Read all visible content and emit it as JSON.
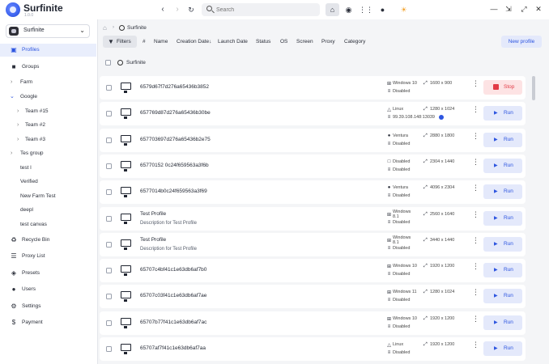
{
  "app": {
    "name": "Surfinite",
    "version": "1.0.0"
  },
  "topbar": {
    "search_placeholder": "Search",
    "back_icon": "chevron-left-icon",
    "forward_icon": "chevron-right-icon",
    "reload_icon": "reload-icon",
    "home_icon": "home-icon",
    "browser_icon": "chrome-icon",
    "sliders_icon": "sliders-icon",
    "account_icon": "account-icon",
    "theme_icon": "sun-icon"
  },
  "sidebar": {
    "workspace": "Surfinite",
    "items": [
      {
        "label": "Profiles",
        "icon": "monitor-icon",
        "active": true
      },
      {
        "label": "Groups",
        "icon": "folder-icon"
      }
    ],
    "groups": [
      {
        "label": "Farm",
        "expanded": false,
        "level": 0
      },
      {
        "label": "Google",
        "expanded": true,
        "level": 0
      },
      {
        "label": "Team #15",
        "level": 1
      },
      {
        "label": "Team #2",
        "level": 1
      },
      {
        "label": "Team #3",
        "level": 1
      },
      {
        "label": "Tes group",
        "expanded": false,
        "level": 0
      },
      {
        "label": "test l",
        "level": 2
      },
      {
        "label": "Verified",
        "level": 2
      },
      {
        "label": "New Farm Test",
        "level": 2
      },
      {
        "label": "deepl",
        "level": 2
      },
      {
        "label": "test canvas",
        "level": 2
      }
    ],
    "bottom_items": [
      {
        "label": "Recycle Bin",
        "icon": "recycle-icon"
      },
      {
        "label": "Proxy List",
        "icon": "proxy-list-icon"
      },
      {
        "label": "Presets",
        "icon": "presets-icon"
      },
      {
        "label": "Users",
        "icon": "users-icon"
      },
      {
        "label": "Settings",
        "icon": "gear-icon"
      },
      {
        "label": "Payment",
        "icon": "dollar-icon"
      }
    ]
  },
  "main": {
    "breadcrumb": "Surfinite",
    "filters_label": "Filters",
    "columns": [
      "#",
      "Name",
      "Creation Date↓",
      "Launch Date",
      "Status",
      "OS",
      "Screen",
      "Proxy",
      "Category"
    ],
    "new_profile_label": "New profile",
    "workspace_tag": "Surfinite",
    "profiles": [
      {
        "name": "6579d67f7d276a65436b3852",
        "desc": "",
        "os": "Windows 10",
        "os_icon": "windows-icon",
        "proxy": "Disabled",
        "proxy_ip": false,
        "resolution": "1600 x 900",
        "action": "Stop"
      },
      {
        "name": "657769d87d276a65436b30be",
        "desc": "",
        "os": "Linux",
        "os_icon": "linux-icon",
        "proxy": "99.39.108.148:13039",
        "proxy_ip": true,
        "resolution": "1280 x 1024",
        "action": "Run"
      },
      {
        "name": "657703697d276a65436b2e75",
        "desc": "",
        "os": "Ventura",
        "os_icon": "apple-icon",
        "proxy": "Disabled",
        "proxy_ip": false,
        "resolution": "2880 x 1800",
        "action": "Run"
      },
      {
        "name": "65770152 0c24f659563a3f6b",
        "desc": "",
        "os": "Disabled",
        "os_icon": "monitor-icon",
        "proxy": "Disabled",
        "proxy_ip": false,
        "resolution": "2304 x 1440",
        "action": "Run"
      },
      {
        "name": "6577014b0c24f659563a3f69",
        "desc": "",
        "os": "Ventura",
        "os_icon": "apple-icon",
        "proxy": "Disabled",
        "proxy_ip": false,
        "resolution": "4096 x 2304",
        "action": "Run"
      },
      {
        "name": "Test Profile",
        "desc": "Description for Test Profile",
        "os": "Windows 8.1",
        "os_icon": "windows-icon",
        "proxy": "Disabled",
        "proxy_ip": false,
        "resolution": "2560 x 1640",
        "action": "Run"
      },
      {
        "name": "Test Profile",
        "desc": "Description for Test Profile",
        "os": "Windows 8.1",
        "os_icon": "windows-icon",
        "proxy": "Disabled",
        "proxy_ip": false,
        "resolution": "3440 x 1440",
        "action": "Run"
      },
      {
        "name": "65707c4bf41c1e63db6af7b0",
        "desc": "",
        "os": "Windows 10",
        "os_icon": "windows-icon",
        "proxy": "Disabled",
        "proxy_ip": false,
        "resolution": "1920 x 1200",
        "action": "Run"
      },
      {
        "name": "65707c03f41c1e63db6af7ae",
        "desc": "",
        "os": "Windows 11",
        "os_icon": "windows-icon",
        "proxy": "Disabled",
        "proxy_ip": false,
        "resolution": "1280 x 1024",
        "action": "Run"
      },
      {
        "name": "65707b77f41c1e63db6af7ac",
        "desc": "",
        "os": "Windows 10",
        "os_icon": "windows-icon",
        "proxy": "Disabled",
        "proxy_ip": false,
        "resolution": "1920 x 1200",
        "action": "Run"
      },
      {
        "name": "65707af7f41c1e63db6af7aa",
        "desc": "",
        "os": "Linux",
        "os_icon": "linux-icon",
        "proxy": "Disabled",
        "proxy_ip": false,
        "resolution": "1920 x 1200",
        "action": "Run"
      }
    ]
  }
}
